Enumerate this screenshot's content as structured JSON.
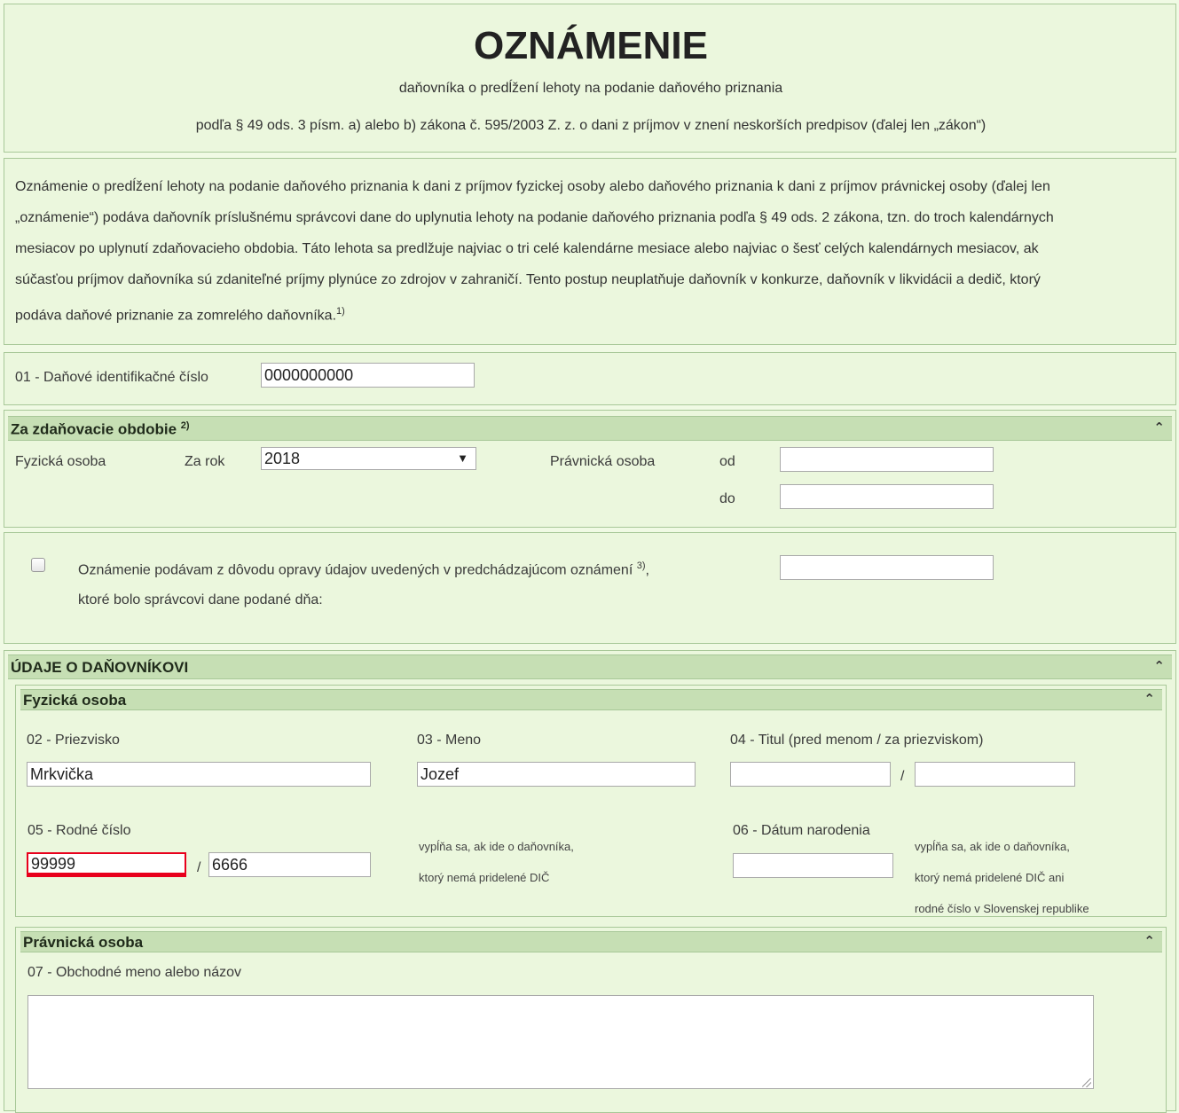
{
  "header": {
    "title": "OZNÁMENIE",
    "subtitle": "daňovníka o predĺžení lehoty na podanie daňového priznania",
    "law_reference": "podľa § 49 ods. 3 písm. a) alebo b) zákona č. 595/2003 Z. z. o dani z príjmov v znení neskorších predpisov (ďalej len „zákon“)"
  },
  "intro": {
    "lines": [
      "Oznámenie o predĺžení lehoty na podanie daňového priznania k dani z príjmov fyzickej osoby alebo daňového priznania k dani z príjmov právnickej osoby (ďalej len",
      "„oznámenie“) podáva daňovník príslušnému správcovi dane do uplynutia lehoty na podanie daňového priznania podľa § 49 ods. 2 zákona, tzn. do troch kalendárnych",
      "mesiacov po uplynutí zdaňovacieho obdobia. Táto lehota sa predlžuje najviac o tri celé kalendárne mesiace alebo najviac o šesť celých kalendárnych mesiacov, ak",
      "súčasťou príjmov daňovníka sú zdaniteľné príjmy plynúce zo zdrojov v zahraničí. Tento postup neuplatňuje daňovník v konkurze, daňovník v likvidácii a dedič, ktorý",
      "podáva daňové priznanie za zomrelého daňovníka."
    ],
    "footnote": "1)"
  },
  "dic": {
    "label": "01 - Daňové identifikačné číslo",
    "value": "0000000000"
  },
  "period": {
    "section_title": "Za zdaňovacie obdobie",
    "section_footnote": "2)",
    "fo_label": "Fyzická osoba",
    "year_label": "Za rok",
    "year_value": "2018",
    "po_label": "Právnická osoba",
    "from_label": "od",
    "to_label": "do",
    "from_value": "",
    "to_value": ""
  },
  "correction": {
    "line1": "Oznámenie podávam z dôvodu opravy údajov uvedených v predchádzajúcom oznámení",
    "footnote": "3)",
    "line2": "ktoré bolo správcovi dane podané dňa:",
    "date_value": ""
  },
  "taxpayer": {
    "section_title": "ÚDAJE O DAŇOVNÍKOVI",
    "fo": {
      "title": "Fyzická osoba",
      "surname_label": "02 - Priezvisko",
      "surname_value": "Mrkvička",
      "name_label": "03 - Meno",
      "name_value": "Jozef",
      "title_label": "04 - Titul (pred menom / za priezviskom)",
      "title_before_value": "",
      "title_after_value": "",
      "slash": "/",
      "birth_no_label": "05 - Rodné číslo",
      "birth_no_part1": "99999",
      "birth_no_part2": "6666",
      "birth_no_note_1": "vypĺňa sa, ak ide o daňovníka,",
      "birth_no_note_2": "ktorý nemá pridelené DIČ",
      "birth_date_label": "06 - Dátum narodenia",
      "birth_date_value": "",
      "birth_date_note_1": "vypĺňa sa, ak ide o daňovníka,",
      "birth_date_note_2": "ktorý nemá pridelené DIČ ani",
      "birth_date_note_3": "rodné číslo v Slovenskej republike"
    },
    "po": {
      "title": "Právnická osoba",
      "business_name_label": "07 - Obchodné meno alebo názov",
      "business_name_value": ""
    }
  },
  "icons": {
    "collapse": "chevron-up-icon",
    "dropdown": "triangle-down-icon"
  },
  "colors": {
    "background": "#ebf7dd",
    "section_bar": "#c6dfb4",
    "error": "#e8001c"
  }
}
